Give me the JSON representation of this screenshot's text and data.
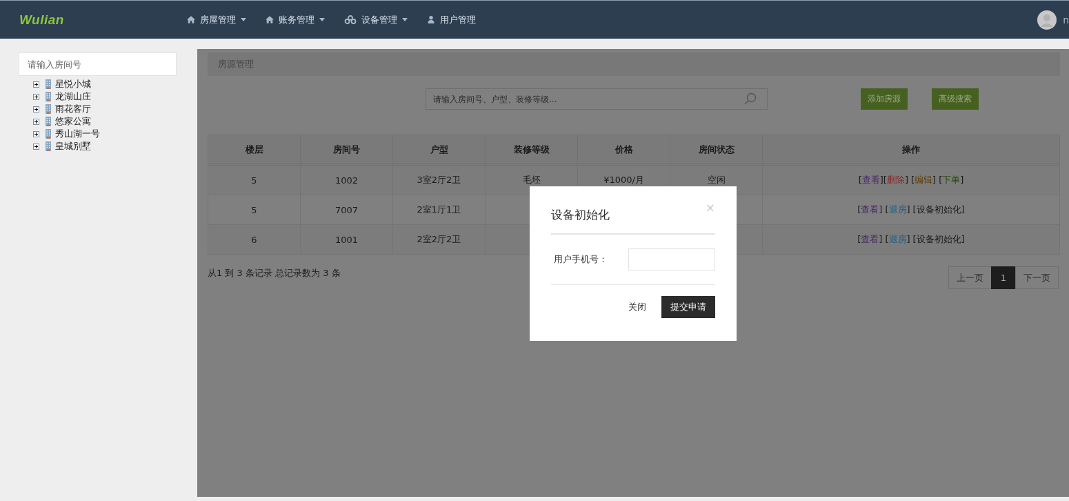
{
  "header": {
    "logo": "Wulian",
    "nav": [
      {
        "label": "房屋管理",
        "dropdown": true
      },
      {
        "label": "账务管理",
        "dropdown": true
      },
      {
        "label": "设备管理",
        "dropdown": true
      },
      {
        "label": "用户管理",
        "dropdown": false
      }
    ],
    "user": "n"
  },
  "sidebar": {
    "search": {
      "placeholder": "请输入房间号"
    },
    "tree": [
      {
        "label": "星悦小城",
        "expanded": false
      },
      {
        "label": "龙湖山庄",
        "expanded": false
      },
      {
        "label": "雨花客厅",
        "expanded": false
      },
      {
        "label": "悠家公寓",
        "expanded": false
      },
      {
        "label": "秀山湖一号",
        "expanded": false
      },
      {
        "label": "皇城别墅",
        "expanded": false
      }
    ]
  },
  "panel": {
    "title": "房源管理",
    "search": {
      "placeholder": "请输入房间号、户型、装修等级..."
    },
    "buttons": [
      "添加房源",
      "高级搜索"
    ],
    "table": {
      "columns": [
        "楼层",
        "房间号",
        "户型",
        "装修等级",
        "价格",
        "房间状态",
        "操作"
      ],
      "rows": [
        {
          "cells": [
            "5",
            "1002",
            "3室2厅2卫",
            "毛坯",
            "¥1000/月",
            "空闲"
          ],
          "actions": [
            {
              "open": "[",
              "label": "查看",
              "close": "]",
              "color": "#4a2a66"
            },
            {
              "open": "[",
              "label": "删除",
              "close": "]",
              "color": "#8a2626"
            },
            {
              "open": "[",
              "label": "编辑",
              "close": "]",
              "color": "#5e3e00"
            },
            {
              "open": "[",
              "label": "下单",
              "close": "]",
              "color": "#264a0c"
            }
          ]
        },
        {
          "cells": [
            "5",
            "7007",
            "2室1厅1卫"
          ],
          "actions": [
            {
              "open": "[",
              "label": "查看",
              "close": "]",
              "color": "#4a2a66"
            },
            {
              "open": "[",
              "label": "退房",
              "close": "]",
              "color": "#1f5f86"
            },
            {
              "open": "[",
              "label": "设备初始化",
              "close": "]",
              "color": "#1a1a1a"
            }
          ]
        },
        {
          "cells": [
            "6",
            "1001",
            "2室2厅2卫"
          ],
          "actions": [
            {
              "open": "[",
              "label": "查看",
              "close": "]",
              "color": "#4a2a66"
            },
            {
              "open": "[",
              "label": "退房",
              "close": "]",
              "color": "#1f5f86"
            },
            {
              "open": "[",
              "label": "设备初始化",
              "close": "]",
              "color": "#1a1a1a"
            }
          ]
        }
      ]
    },
    "summary": "从1 到 3 条记录 总记录数为 3 条",
    "pagination": [
      {
        "label": "上一页",
        "selected": false
      },
      {
        "label": "1",
        "selected": true
      },
      {
        "label": "下一页",
        "selected": false
      }
    ]
  },
  "modal": {
    "title": "设备初始化",
    "close": "×",
    "field": {
      "label": "用户手机号："
    },
    "buttons": [
      {
        "label": "关闭",
        "kind": "plain"
      },
      {
        "label": "提交申请",
        "kind": "primary"
      }
    ]
  }
}
